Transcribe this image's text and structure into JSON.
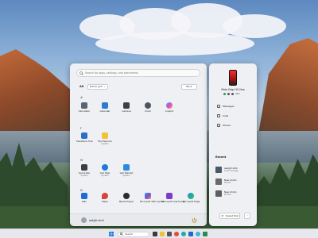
{
  "search": {
    "placeholder": "Search for apps, settings, and documents"
  },
  "header": {
    "all_label": "All",
    "view_label": "Name grid",
    "back_label": "Back"
  },
  "letters": [
    "#",
    "F",
    "M",
    "N"
  ],
  "apps": [
    {
      "name": "Calculator",
      "sub": ""
    },
    {
      "name": "Calendar",
      "sub": ""
    },
    {
      "name": "Camera",
      "sub": ""
    },
    {
      "name": "Clock",
      "sub": ""
    },
    {
      "name": "Copilot",
      "sub": ""
    },
    {
      "name": "Feedback Hub",
      "sub": ""
    },
    {
      "name": "File Explorer",
      "sub": "System"
    },
    {
      "name": "Game Bar",
      "sub": "System"
    },
    {
      "name": "Get Help",
      "sub": "System"
    },
    {
      "name": "Get Started",
      "sub": "System"
    },
    {
      "name": "Mail",
      "sub": ""
    },
    {
      "name": "Maps",
      "sub": ""
    },
    {
      "name": "Media Player",
      "sub": ""
    },
    {
      "name": "Microsoft 365 Copilot",
      "sub": ""
    },
    {
      "name": "Microsoft Clipchamp",
      "sub": ""
    },
    {
      "name": "Microsoft Edge",
      "sub": ""
    }
  ],
  "user": {
    "name": "aakjjkt strik"
  },
  "phone": {
    "model": "Moto Edge 50 Neo",
    "battery": "47%",
    "items": [
      "Messages",
      "Calls",
      "Photos"
    ],
    "recent_label": "Recent",
    "recent": [
      {
        "title": "aakjjkt strik",
        "sub": "Sent message"
      },
      {
        "title": "New photo",
        "sub": "Photos"
      },
      {
        "title": "New photo",
        "sub": "Photos"
      }
    ],
    "speed_dial": "Speed Dial",
    "more": "..."
  },
  "taskbar": {
    "search": "Search"
  },
  "colors": {
    "accent": "#0067c0",
    "panel": "#eef0f3"
  }
}
